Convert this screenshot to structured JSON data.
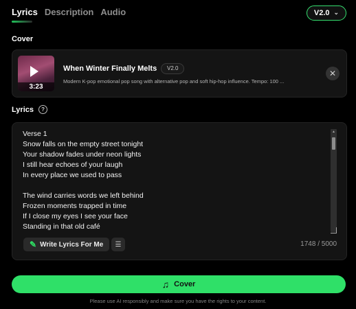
{
  "tabs": [
    {
      "label": "Lyrics"
    },
    {
      "label": "Description"
    },
    {
      "label": "Audio"
    }
  ],
  "version_select": {
    "value": "V2.0"
  },
  "cover_section": {
    "title": "Cover",
    "song": {
      "title": "When Winter Finally Melts",
      "badge": "V2.0",
      "description": "Modern K-pop emotional pop song with alternative pop and soft hip-hop influence. Tempo: 100 ...",
      "duration": "3:23"
    }
  },
  "lyrics_section": {
    "title": "Lyrics",
    "lines": [
      "Verse 1",
      "Snow falls on the empty street tonight",
      "Your shadow fades under neon lights",
      "I still hear echoes of your laugh",
      "In every place we used to pass",
      "",
      "The wind carries words we left behind",
      "Frozen moments trapped in time",
      "If I close my eyes I see your face",
      "Standing in that old café"
    ],
    "write_button_label": "Write Lyrics For Me",
    "char_count": "1748 / 5000"
  },
  "actions": {
    "cover_button_label": "Cover",
    "disclaimer": "Please use AI responsibly and make sure you have the rights to your content."
  },
  "colors": {
    "accent": "#2fe068",
    "background": "#000000",
    "card": "#141414"
  },
  "icons": {
    "help": "question-circle-icon",
    "play": "play-icon",
    "close": "close-icon",
    "write": "pen-icon",
    "format": "list-format-icon",
    "cover": "music-note-icon",
    "dropdown": "chevron-down-icon"
  }
}
